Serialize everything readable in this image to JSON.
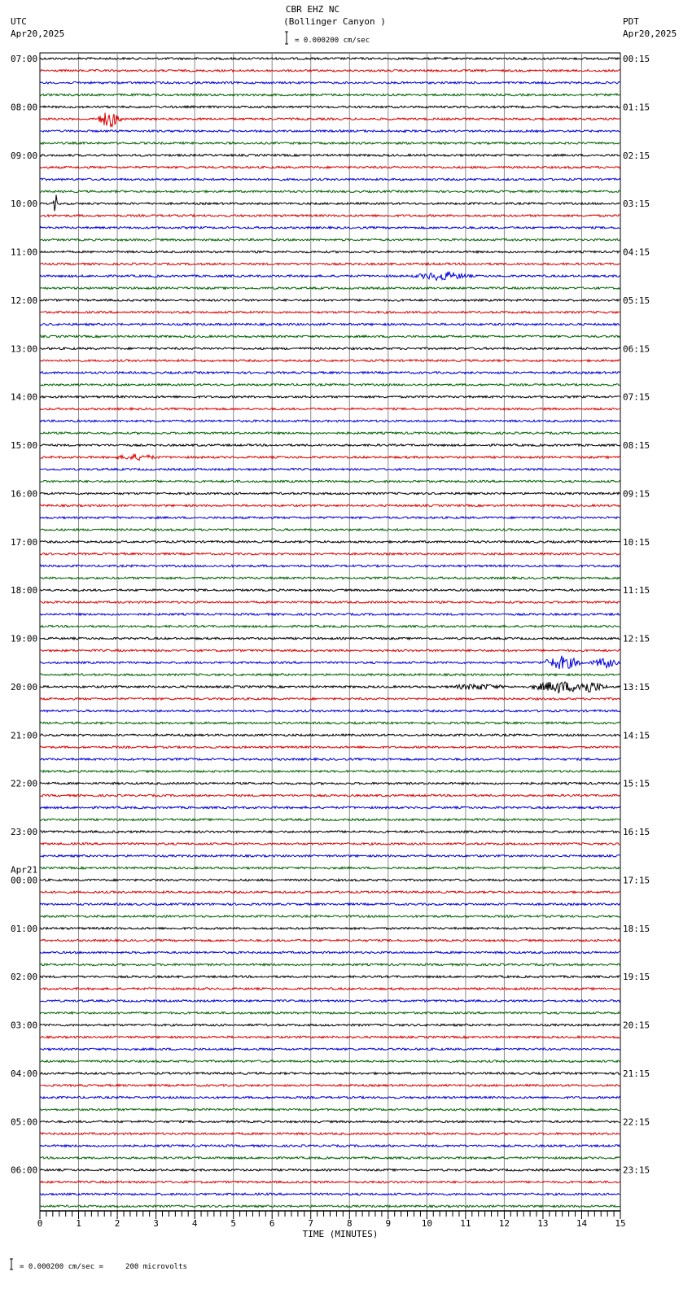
{
  "header": {
    "station": "CBR EHZ NC",
    "location": "(Bollinger Canyon )",
    "left_tz": "UTC",
    "left_date": "Apr20,2025",
    "right_tz": "PDT",
    "right_date": "Apr20,2025",
    "scale_text": "= 0.000200 cm/sec"
  },
  "footer": {
    "scale_text": "= 0.000200 cm/sec =     200 microvolts"
  },
  "chart_data": {
    "type": "line",
    "title": "CBR EHZ NC (Bollinger Canyon )",
    "xlabel": "TIME (MINUTES)",
    "xlim": [
      0,
      15
    ],
    "x_ticks": [
      "0",
      "1",
      "2",
      "3",
      "4",
      "5",
      "6",
      "7",
      "8",
      "9",
      "10",
      "11",
      "12",
      "13",
      "14",
      "15"
    ],
    "traces_per_hour": 4,
    "trace_count": 96,
    "trace_colors": [
      "#000000",
      "#dd0000",
      "#0000dd",
      "#006400"
    ],
    "left_hour_labels": [
      "07:00",
      "08:00",
      "09:00",
      "10:00",
      "11:00",
      "12:00",
      "13:00",
      "14:00",
      "15:00",
      "16:00",
      "17:00",
      "18:00",
      "19:00",
      "20:00",
      "21:00",
      "22:00",
      "23:00",
      "00:00",
      "01:00",
      "02:00",
      "03:00",
      "04:00",
      "05:00",
      "06:00"
    ],
    "day_change_label": "Apr21",
    "day_change_index": 17,
    "right_hour_labels": [
      "00:15",
      "01:15",
      "02:15",
      "03:15",
      "04:15",
      "05:15",
      "06:15",
      "07:15",
      "08:15",
      "09:15",
      "10:15",
      "11:15",
      "12:15",
      "13:15",
      "14:15",
      "15:15",
      "16:15",
      "17:15",
      "18:15",
      "19:15",
      "20:15",
      "21:15",
      "22:15",
      "23:15"
    ],
    "events": [
      {
        "trace": 5,
        "minute": 1.8,
        "amplitude": 10,
        "duration": 0.4
      },
      {
        "trace": 12,
        "minute": 0.4,
        "amplitude": 16,
        "duration": 0.05
      },
      {
        "trace": 18,
        "minute": 10.4,
        "amplitude": 5,
        "duration": 0.8
      },
      {
        "trace": 33,
        "minute": 2.5,
        "amplitude": 3,
        "duration": 0.6
      },
      {
        "trace": 50,
        "minute": 13.5,
        "amplitude": 8,
        "duration": 0.6
      },
      {
        "trace": 50,
        "minute": 14.6,
        "amplitude": 6,
        "duration": 0.4
      },
      {
        "trace": 52,
        "minute": 13.4,
        "amplitude": 7,
        "duration": 0.8
      },
      {
        "trace": 52,
        "minute": 14.2,
        "amplitude": 7,
        "duration": 0.5
      },
      {
        "trace": 52,
        "minute": 11.3,
        "amplitude": 3,
        "duration": 0.8
      }
    ]
  }
}
